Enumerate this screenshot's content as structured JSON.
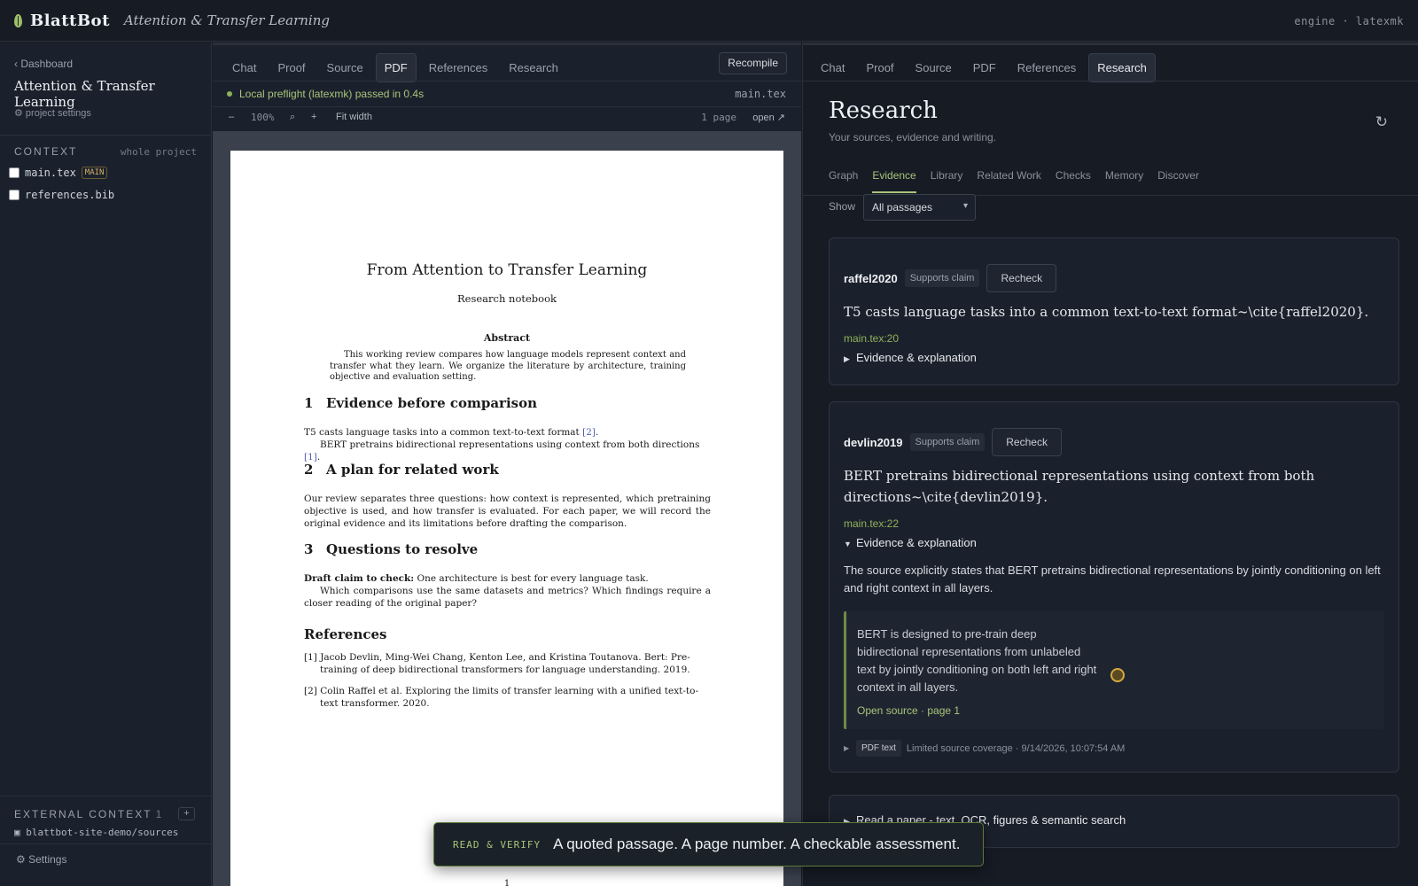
{
  "app": {
    "logo_text": "BlattBot",
    "project_title": "Attention & Transfer Learning",
    "engine_label": "engine · latexmk"
  },
  "sidebar": {
    "back_label": "‹ Dashboard",
    "project_title": "Attention & Transfer Learning",
    "project_settings": "⚙ project settings",
    "context_label": "CONTEXT",
    "context_scope": "whole project",
    "files": [
      {
        "name": "main.tex",
        "badge": "MAIN",
        "checked": false
      },
      {
        "name": "references.bib",
        "badge": "",
        "checked": false
      }
    ],
    "external_context_label": "EXTERNAL CONTEXT",
    "external_context_count": "1",
    "external_add": "+",
    "external_item": "▣ blattbot-site-demo/sources",
    "settings_label": "⚙ Settings"
  },
  "editor": {
    "tabs": [
      "Chat",
      "Proof",
      "Source",
      "PDF",
      "References",
      "Research"
    ],
    "active_tab": "PDF",
    "recompile_label": "Recompile",
    "preflight_text": "Local preflight (latexmk) passed in 0.4s",
    "preflight_file": "main.tex",
    "toolbar": {
      "zoom_out": "–",
      "zoom_level": "100%",
      "zoom_fit_icon": "⌕",
      "zoom_in": "+",
      "fit_width": "Fit width",
      "page_count": "1 page",
      "open_label": "open ↗"
    }
  },
  "pdf": {
    "title": "From Attention to Transfer Learning",
    "subtitle": "Research notebook",
    "abstract_heading": "Abstract",
    "abstract_text": "This working review compares how language models represent context and transfer what they learn. We organize the literature by architecture, training objective and evaluation setting.",
    "sections": [
      {
        "num": "1",
        "title": "Evidence before comparison"
      },
      {
        "num": "2",
        "title": "A plan for related work"
      },
      {
        "num": "3",
        "title": "Questions to resolve"
      }
    ],
    "s1_line1_text": "T5 casts language tasks into a common text-to-text format ",
    "s1_line1_cite": "[2]",
    "s1_line2_text": "BERT pretrains bidirectional representations using context from both directions ",
    "s1_line2_cite": "[1]",
    "s2_paragraph": "Our review separates three questions: how context is represented, which pretraining objective is used, and how transfer is evaluated. For each paper, we will record the original evidence and its limitations before drafting the comparison.",
    "s3_bold": "Draft claim to check:",
    "s3_claim": " One architecture is best for every language task.",
    "s3_paragraph": "Which comparisons use the same datasets and metrics? Which findings require a closer reading of the original paper?",
    "references_heading": "References",
    "references": [
      "[1]  Jacob Devlin, Ming-Wei Chang, Kenton Lee, and Kristina Toutanova. Bert: Pre-training of deep bidirectional transformers for language understanding. 2019.",
      "[2]  Colin Raffel et al. Exploring the limits of transfer learning with a unified text-to-text transformer. 2020."
    ],
    "page_number": "1"
  },
  "research": {
    "tabs": [
      "Chat",
      "Proof",
      "Source",
      "PDF",
      "References",
      "Research"
    ],
    "active_tab": "Research",
    "title": "Research",
    "subtitle": "Your sources, evidence and writing.",
    "refresh_icon": "↻",
    "subtabs": [
      "Graph",
      "Evidence",
      "Library",
      "Related Work",
      "Checks",
      "Memory",
      "Discover"
    ],
    "active_subtab": "Evidence",
    "show_label": "Show",
    "show_value": "All passages",
    "cards": [
      {
        "key": "raffel2020",
        "badge": "Supports claim",
        "recheck": "Recheck",
        "claim": "T5 casts language tasks into a common text-to-text format~\\cite{raffel2020}.",
        "location": "main.tex:20",
        "details_label": "Evidence & explanation",
        "expanded": false
      },
      {
        "key": "devlin2019",
        "badge": "Supports claim",
        "recheck": "Recheck",
        "claim": "BERT pretrains bidirectional representations using context from both directions~\\cite{devlin2019}.",
        "location": "main.tex:22",
        "details_label": "Evidence & explanation",
        "expanded": true,
        "explanation": "The source explicitly states that BERT pretrains bidirectional representations by jointly conditioning on left and right context in all layers.",
        "quote": "BERT is designed to pre-train deep bidirectional representations from unlabeled text by jointly conditioning on both left and right context in all layers.",
        "open_source": "Open source · page 1",
        "meta_badge": "PDF text",
        "meta_text": "Limited source coverage · 9/14/2026, 10:07:54 AM"
      }
    ],
    "read_paper_label": "Read a paper - text, OCR, figures & semantic search"
  },
  "toast": {
    "tag": "READ & VERIFY",
    "message": "A quoted passage. A page number. A checkable assessment."
  },
  "colors": {
    "accent": "#a8c47a",
    "background": "#161b24",
    "panel": "#1b212c",
    "badge_main": "#d7b36a"
  }
}
